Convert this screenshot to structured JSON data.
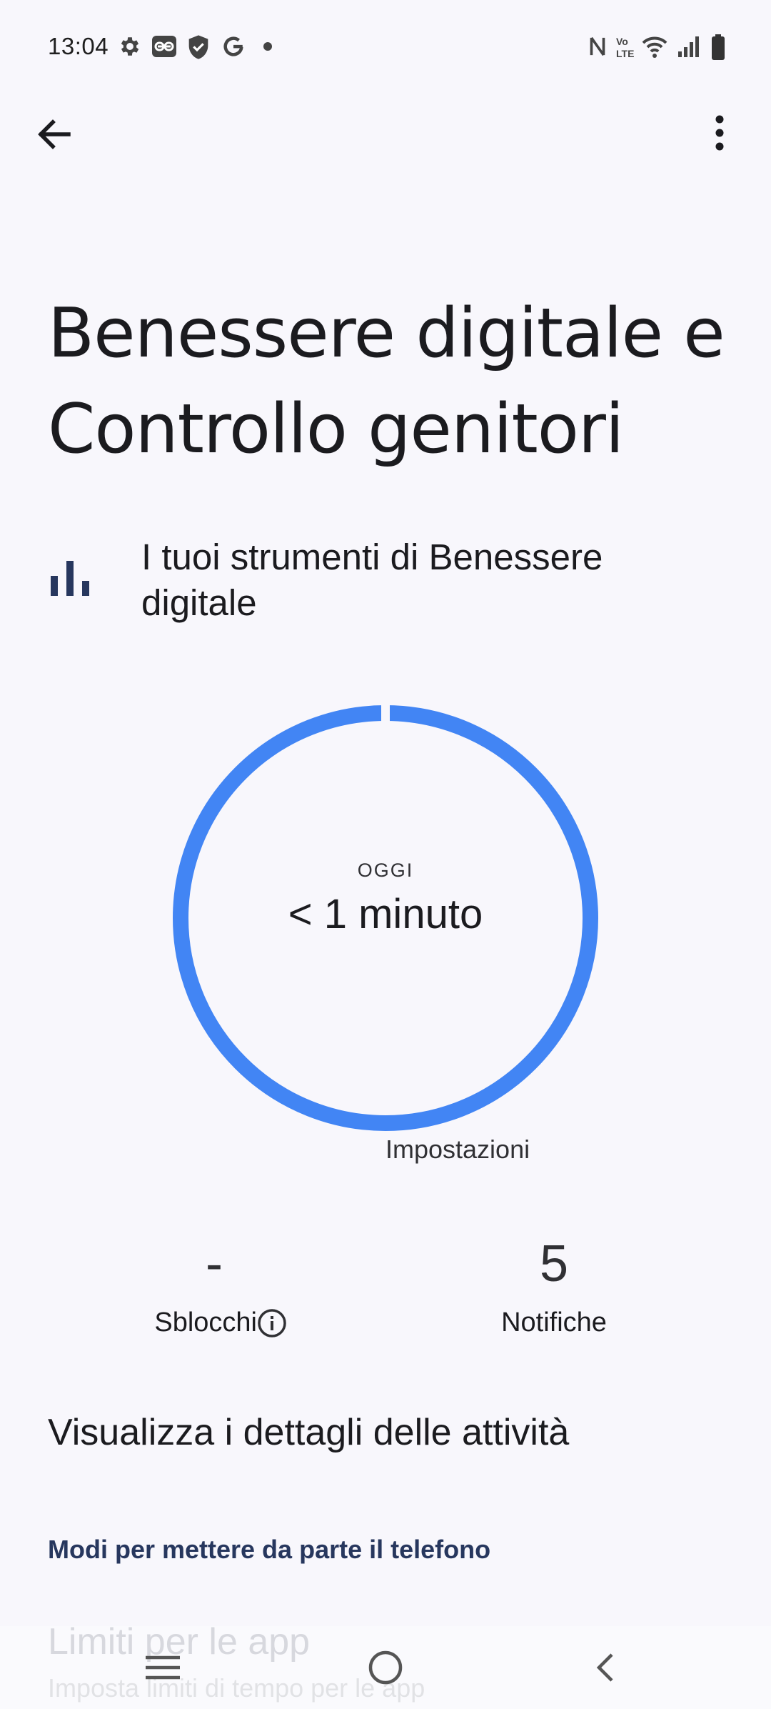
{
  "status_bar": {
    "time": "13:04",
    "left_icons": [
      "gear-icon",
      "link-icon",
      "shield-icon",
      "google-icon",
      "dot-icon"
    ],
    "right_icons": [
      "nfc-icon",
      "volte-icon",
      "wifi-icon",
      "signal-icon",
      "battery-icon"
    ]
  },
  "app_bar": {
    "back_icon": "arrow-left-icon",
    "menu_icon": "more-vert-icon"
  },
  "page": {
    "title_line1": "Benessere digitale e",
    "title_line2": "Controllo genitori"
  },
  "section": {
    "icon": "bar-chart-icon",
    "title": "I tuoi strumenti di Benessere digitale"
  },
  "usage_ring": {
    "label": "OGGI",
    "value": "< 1 minuto",
    "legend": "Impostazioni",
    "color": "#4285f4"
  },
  "stats": {
    "unlocks_value": "-",
    "unlocks_label": "Sblocchi",
    "notifications_value": "5",
    "notifications_label": "Notifiche"
  },
  "details_link": "Visualizza i dettagli delle attività",
  "subheader": "Modi per mettere da parte il telefono",
  "list_item": {
    "title": "Limiti per le app",
    "subtitle": "Imposta limiti di tempo per le app"
  },
  "nav_bar": {
    "icons": [
      "menu-icon",
      "home-icon",
      "back-icon"
    ]
  },
  "colors": {
    "accent": "#4285f4",
    "subheader": "#27375e",
    "background": "#f8f7fc"
  }
}
